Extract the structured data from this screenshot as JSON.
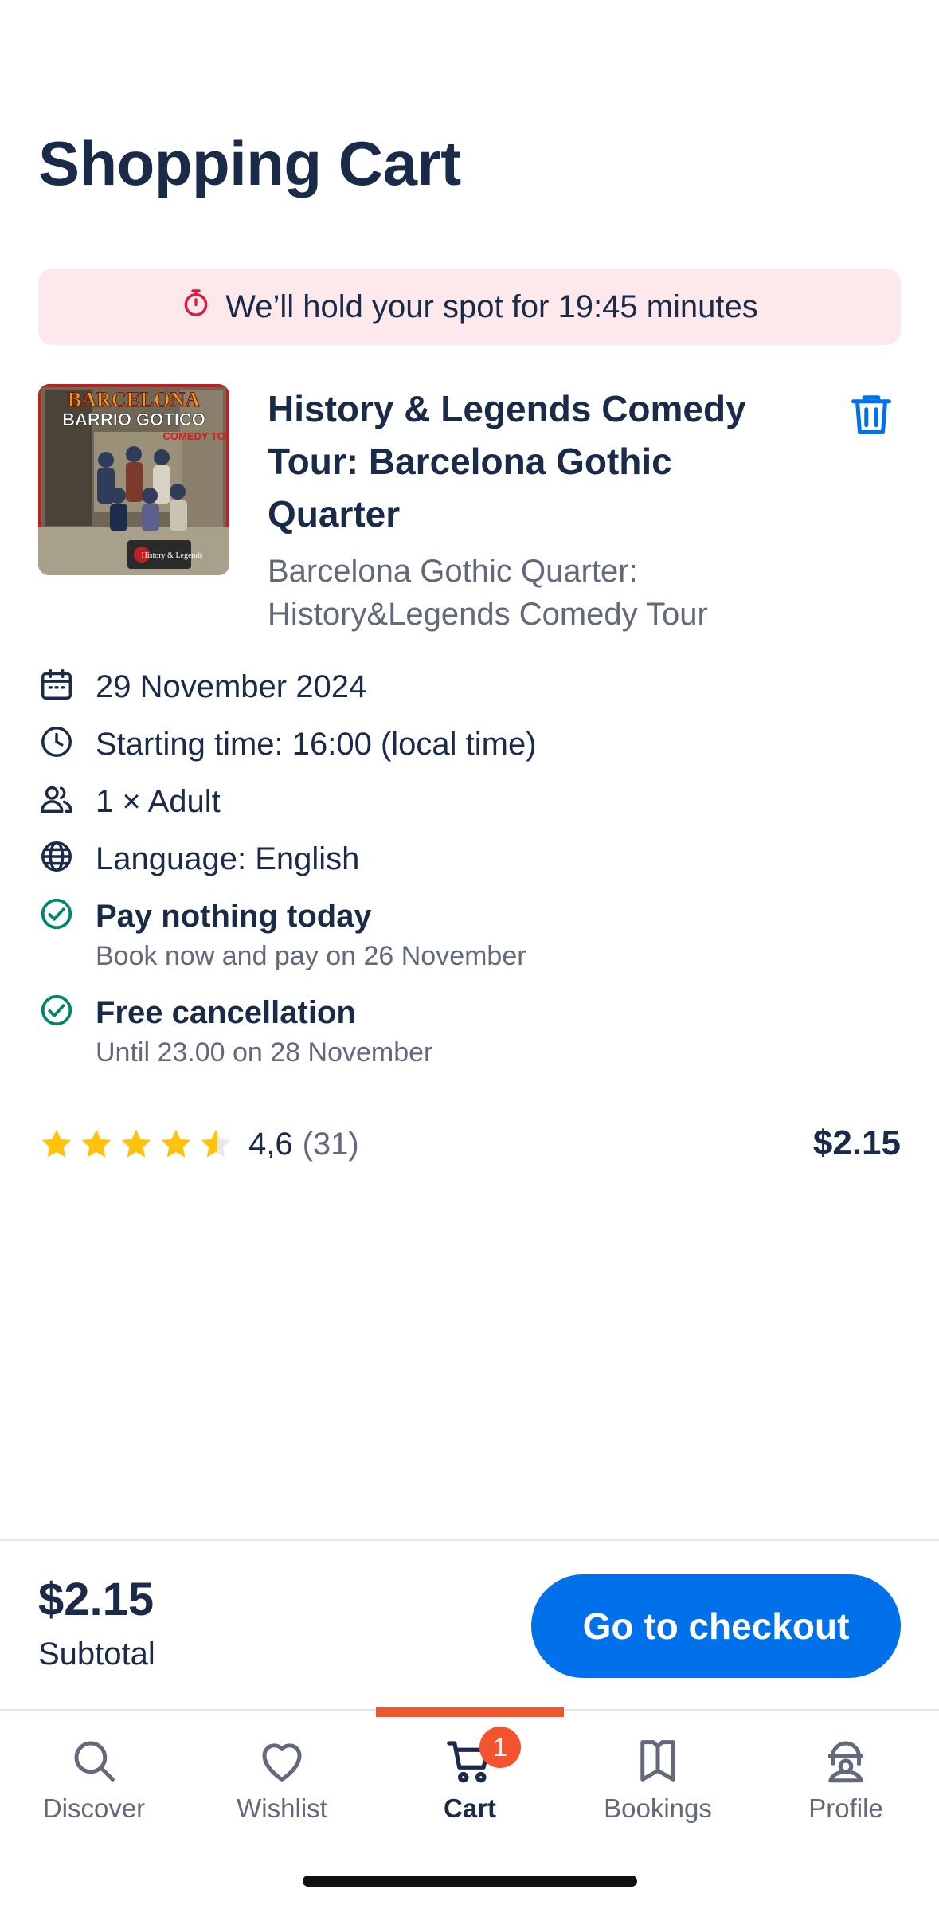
{
  "header": {
    "title": "Shopping Cart"
  },
  "hold_banner": {
    "text": "We’ll hold your spot for 19:45 minutes"
  },
  "item": {
    "image_alt": "Barcelona Barrio Gotico comedy tour photo",
    "image_text": {
      "line1": "BARCELONA",
      "line2": "BARRIO GOTICO",
      "line3": "COMEDY TOUR",
      "logo": "History & Legends"
    },
    "title": "History & Legends Comedy Tour: Barcelona Gothic Quarter",
    "subtitle": "Barcelona Gothic Quarter: History&Legends Comedy Tour",
    "details": {
      "date": "29 November 2024",
      "start_time": "Starting time: 16:00 (local time)",
      "participants": "1 × Adult",
      "language": "Language: English",
      "pay_title": "Pay nothing today",
      "pay_note": "Book now and pay on 26 November",
      "cancel_title": "Free cancellation",
      "cancel_note": "Until 23.00 on 28 November"
    },
    "rating": {
      "value": "4,6",
      "count": "(31)",
      "stars": 4.6
    },
    "price": "$2.15"
  },
  "checkout": {
    "subtotal_price": "$2.15",
    "subtotal_label": "Subtotal",
    "button_label": "Go to checkout"
  },
  "tabbar": {
    "tabs": [
      {
        "label": "Discover",
        "icon": "search-icon"
      },
      {
        "label": "Wishlist",
        "icon": "heart-icon"
      },
      {
        "label": "Cart",
        "icon": "cart-icon",
        "active": true,
        "badge": "1"
      },
      {
        "label": "Bookings",
        "icon": "bookmark-icon"
      },
      {
        "label": "Profile",
        "icon": "profile-icon"
      }
    ]
  },
  "colors": {
    "accent": "#0071eb",
    "text": "#1a2b49",
    "muted": "#63687a",
    "banner": "#fde8ec",
    "alert": "#f2542d",
    "success": "#008768",
    "star": "#ffc30e"
  }
}
